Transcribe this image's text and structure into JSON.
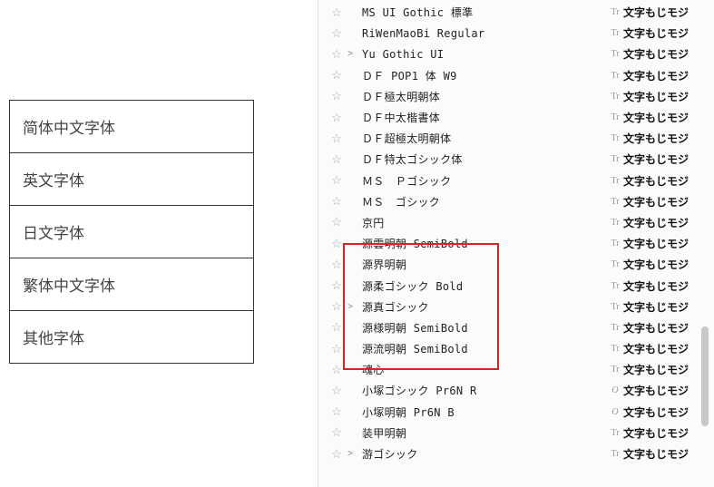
{
  "categories": [
    {
      "label": "简体中文字体"
    },
    {
      "label": "英文字体"
    },
    {
      "label": "日文字体"
    },
    {
      "label": "繁体中文字体"
    },
    {
      "label": "其他字体"
    }
  ],
  "sample_text": "文字もじモジ",
  "font_type_tt": "Tr",
  "font_type_o": "O",
  "fonts": [
    {
      "name": "MS UI Gothic 標準",
      "expand": "",
      "type": "Tr"
    },
    {
      "name": "RiWenMaoBi Regular",
      "expand": "",
      "type": "Tr"
    },
    {
      "name": "Yu Gothic UI",
      "expand": ">",
      "type": "Tr"
    },
    {
      "name": "ＤＦ POP1 体 W9",
      "expand": "",
      "type": "Tr"
    },
    {
      "name": "ＤＦ極太明朝体",
      "expand": "",
      "type": "Tr"
    },
    {
      "name": "ＤＦ中太楷書体",
      "expand": "",
      "type": "Tr"
    },
    {
      "name": "ＤＦ超極太明朝体",
      "expand": "",
      "type": "Tr"
    },
    {
      "name": "ＤＦ特太ゴシック体",
      "expand": "",
      "type": "Tr"
    },
    {
      "name": "ＭＳ　Ｐゴシック",
      "expand": "",
      "type": "Tr"
    },
    {
      "name": "ＭＳ　ゴシック",
      "expand": "",
      "type": "Tr"
    },
    {
      "name": "京円",
      "expand": "",
      "type": "Tr"
    },
    {
      "name": "源雲明朝 SemiBold",
      "expand": "",
      "type": "Tr"
    },
    {
      "name": "源界明朝",
      "expand": "",
      "type": "Tr"
    },
    {
      "name": "源柔ゴシック Bold",
      "expand": "",
      "type": "Tr"
    },
    {
      "name": "源真ゴシック",
      "expand": ">",
      "type": "Tr"
    },
    {
      "name": "源様明朝 SemiBold",
      "expand": "",
      "type": "Tr"
    },
    {
      "name": "源流明朝 SemiBold",
      "expand": "",
      "type": "Tr"
    },
    {
      "name": "魂心",
      "expand": "",
      "type": "Tr"
    },
    {
      "name": "小塚ゴシック Pr6N R",
      "expand": "",
      "type": "O"
    },
    {
      "name": "小塚明朝 Pr6N B",
      "expand": "",
      "type": "O"
    },
    {
      "name": "装甲明朝",
      "expand": "",
      "type": "Tr"
    },
    {
      "name": "游ゴシック",
      "expand": ">",
      "type": "Tr"
    }
  ]
}
